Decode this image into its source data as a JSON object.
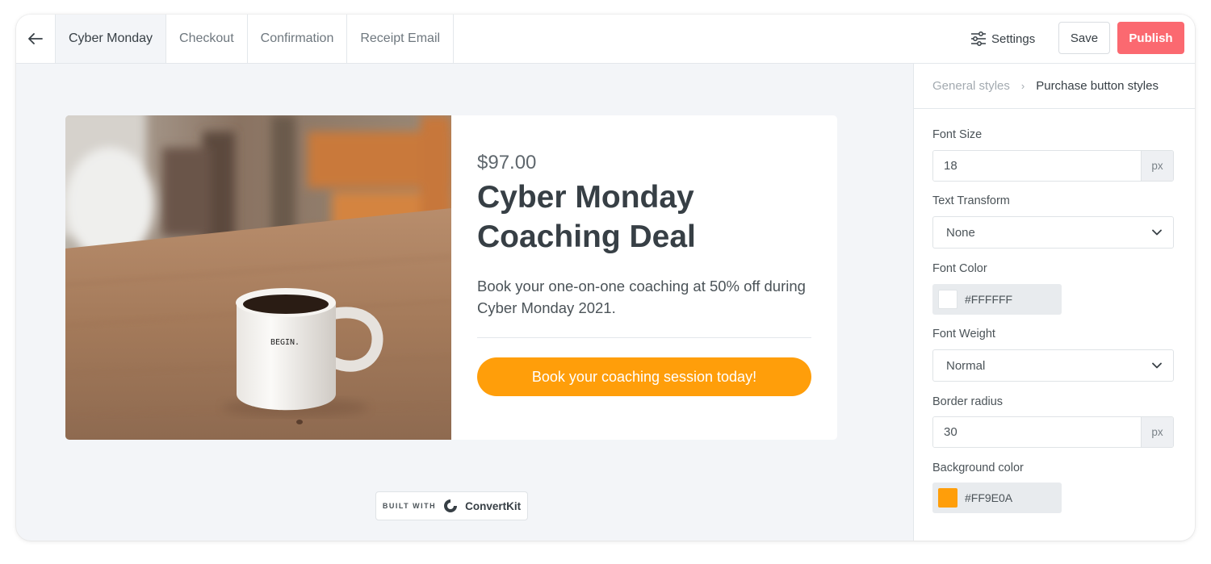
{
  "topbar": {
    "tabs": [
      {
        "label": "Cyber Monday",
        "active": true
      },
      {
        "label": "Checkout",
        "active": false
      },
      {
        "label": "Confirmation",
        "active": false
      },
      {
        "label": "Receipt Email",
        "active": false
      }
    ],
    "settings_label": "Settings",
    "save_label": "Save",
    "publish_label": "Publish"
  },
  "product": {
    "price": "$97.00",
    "title": "Cyber Monday Coaching Deal",
    "description": "Book your one-on-one coaching at 50% off during Cyber Monday 2021.",
    "button_label": "Book your coaching session today!",
    "mug_text": "BEGIN."
  },
  "badge": {
    "built_with": "BUILT WITH",
    "brand": "ConvertKit"
  },
  "panel": {
    "breadcrumb_parent": "General styles",
    "breadcrumb_current": "Purchase button styles",
    "font_size": {
      "label": "Font Size",
      "value": "18",
      "unit": "px"
    },
    "text_transform": {
      "label": "Text Transform",
      "value": "None"
    },
    "font_color": {
      "label": "Font Color",
      "value": "#FFFFFF"
    },
    "font_weight": {
      "label": "Font Weight",
      "value": "Normal"
    },
    "border_radius": {
      "label": "Border radius",
      "value": "30",
      "unit": "px"
    },
    "background_color": {
      "label": "Background color",
      "value": "#FF9E0A"
    }
  },
  "colors": {
    "publish": "#FB6970",
    "button_orange": "#FF9E0A",
    "canvas_bg": "#F3F5F8"
  }
}
